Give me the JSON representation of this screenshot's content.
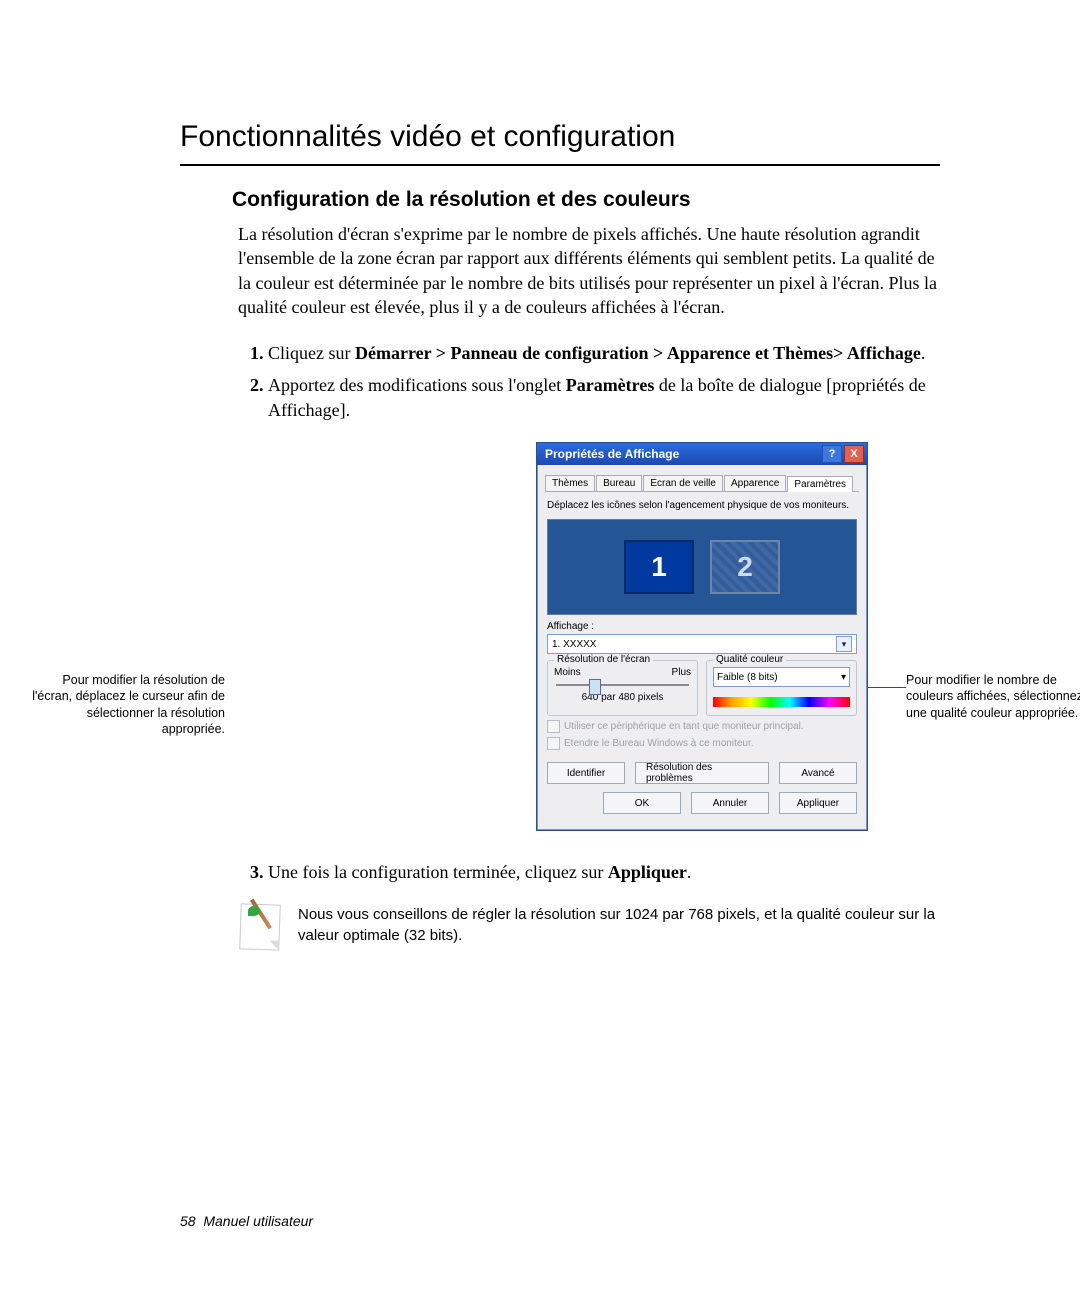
{
  "page": {
    "chapter": "Fonctionnalités vidéo et configuration",
    "section": "Configuration de la résolution et des couleurs",
    "intro": "La résolution d'écran s'exprime par le nombre de pixels affichés. Une haute résolution agrandit l'ensemble de la zone écran par rapport aux différents éléments qui semblent petits. La qualité de la couleur est déterminée par le nombre de bits utilisés pour représenter un pixel à l'écran. Plus la qualité couleur est élevée, plus il y a de couleurs affichées à l'écran.",
    "step1_prefix": "Cliquez sur ",
    "step1_bold": "Démarrer > Panneau de configuration > Apparence et Thèmes> Affichage",
    "step1_suffix": ".",
    "step2_prefix": "Apportez des modifications sous l'onglet ",
    "step2_bold": "Paramètres",
    "step2_suffix": " de la boîte de dialogue [propriétés de Affichage].",
    "step3_prefix": "Une fois la configuration terminée, cliquez sur ",
    "step3_bold": "Appliquer",
    "step3_suffix": ".",
    "note": "Nous vous conseillons de régler la résolution sur 1024 par 768 pixels, et la qualité couleur sur la valeur optimale (32 bits).",
    "footer_num": "58",
    "footer_text": "Manuel utilisateur"
  },
  "callouts": {
    "left": "Pour modifier la résolution de l'écran, déplacez le curseur afin de sélectionner la résolution appropriée.",
    "right": "Pour modifier le nombre de couleurs affichées, sélectionnez une qualité couleur appropriée."
  },
  "dialog": {
    "title": "Propriétés de Affichage",
    "help": "?",
    "close": "X",
    "tabs": [
      "Thèmes",
      "Bureau",
      "Ecran de veille",
      "Apparence",
      "Paramètres"
    ],
    "active_tab_index": 4,
    "instruction": "Déplacez les icônes selon l'agencement physique de vos moniteurs.",
    "mon1": "1",
    "mon2": "2",
    "display_label": "Affichage :",
    "display_value": "1. XXXXX",
    "res_legend": "Résolution de l'écran",
    "res_min": "Moins",
    "res_max": "Plus",
    "res_value": "640 par 480 pixels",
    "color_legend": "Qualité couleur",
    "color_value": "Faible (8 bits)",
    "check1": "Utiliser ce périphérique en tant que moniteur principal.",
    "check2": "Etendre le Bureau Windows à ce moniteur.",
    "btn_identify": "Identifier",
    "btn_trouble": "Résolution des problèmes",
    "btn_adv": "Avancé",
    "btn_ok": "OK",
    "btn_cancel": "Annuler",
    "btn_apply": "Appliquer"
  }
}
